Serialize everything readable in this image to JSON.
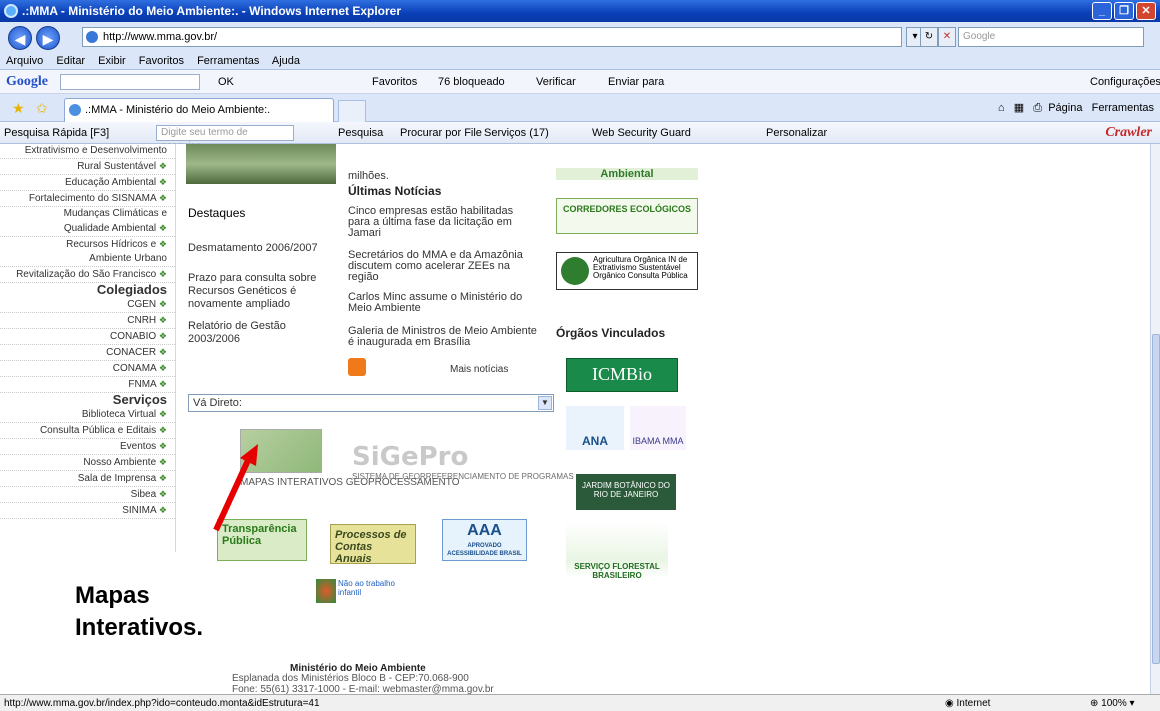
{
  "window": {
    "title": ".:MMA - Ministério do Meio Ambiente:. - Windows Internet Explorer"
  },
  "address": {
    "url": "http://www.mma.gov.br/",
    "search_placeholder": "Google"
  },
  "menu": [
    "Arquivo",
    "Editar",
    "Exibir",
    "Favoritos",
    "Ferramentas",
    "Ajuda"
  ],
  "google": {
    "logo": "Google",
    "ok": "OK",
    "favoritos": "Favoritos",
    "bloqueado": "76 bloqueado",
    "verificar": "Verificar",
    "enviar": "Enviar para",
    "configuracoes": "Configurações"
  },
  "tab": {
    "label": ".:MMA - Ministério do Meio Ambiente:."
  },
  "tabtools": {
    "pagina": "Página",
    "ferramentas": "Ferramentas"
  },
  "crawl": {
    "quick": "Pesquisa Rápida [F3]",
    "input_placeholder": "Digite seu termo de pesquisa...",
    "pesquisa": "Pesquisa",
    "procurar": "Procurar por File",
    "servicos": "Serviços (17)",
    "guard": "Web Security Guard",
    "personalizar": "Personalizar",
    "brand": "Crawler"
  },
  "sidebar": {
    "items_top": [
      "Extrativismo e Desenvolvimento",
      "Rural Sustentável",
      "Educação Ambiental",
      "Fortalecimento do SISNAMA",
      "Mudanças Climáticas e",
      "Qualidade Ambiental",
      "Recursos Hídricos e",
      "Ambiente Urbano",
      "Revitalização do São Francisco"
    ],
    "colegiados_title": "Colegiados",
    "colegiados": [
      "CGEN",
      "CNRH",
      "CONABIO",
      "CONACER",
      "CONAMA",
      "FNMA"
    ],
    "servicos_title": "Serviços",
    "servicos": [
      "Biblioteca Virtual",
      "Consulta Pública e Editais",
      "Eventos",
      "Nosso Ambiente",
      "Sala de Imprensa",
      "Sibea",
      "SINIMA"
    ]
  },
  "destaques": {
    "title": "Destaques",
    "links": [
      "Desmatamento 2006/2007",
      "Prazo para consulta sobre Recursos Genéticos é novamente ampliado",
      "Relatório de Gestão 2003/2006"
    ]
  },
  "news": {
    "milhoes": "milhões.",
    "title": "Últimas Notícias",
    "items": [
      "Cinco empresas estão habilitadas para a última fase da licitação em Jamari",
      "Secretários do MMA e da Amazônia discutem como acelerar ZEEs na região",
      "Carlos Minc assume o Ministério do Meio Ambiente",
      "Galeria de Ministros de Meio Ambiente é inaugurada em Brasília"
    ],
    "mais": "Mais notícias"
  },
  "vadireto": {
    "label": "Vá Direto:"
  },
  "mapas": {
    "label": "MAPAS INTERATIVOS GEOPROCESSAMENTO",
    "annotation": "Mapas Interativos."
  },
  "sigepro": {
    "title": "SiGePro",
    "sub": "SISTEMA DE GEORREFERENCIAMENTO DE PROGRAMAS"
  },
  "banners": {
    "transparencia": "Transparência Pública",
    "processos": "Processos de Contas Anuais",
    "aaa": "AAA",
    "aaa_sub": "APROVADO ACESSIBILIDADE BRASIL",
    "naotrab": "Não ao trabalho infantil"
  },
  "right": {
    "ambiental": "Ambiental",
    "corredores": "CORREDORES ECOLÓGICOS",
    "agricultura": "Agricultura Orgânica IN de Extrativismo Sustentável Orgânico Consulta Pública",
    "orgaos": "Órgãos Vinculados",
    "icmbio": "ICMBio",
    "ana": "ANA",
    "ibama": "IBAMA MMA",
    "jardim": "JARDIM BOTÂNICO DO RIO DE JANEIRO",
    "florestal": "SERVIÇO FLORESTAL BRASILEIRO"
  },
  "footer": {
    "org": "Ministério do Meio Ambiente",
    "addr": "Esplanada dos Ministérios Bloco B - CEP:70.068-900",
    "fone": "Fone: 55(61) 3317-1000 - E-mail: webmaster@mma.gov.br"
  },
  "status": {
    "url": "http://www.mma.gov.br/index.php?ido=conteudo.monta&idEstrutura=41",
    "zone": "Internet",
    "zoom": "100%"
  }
}
